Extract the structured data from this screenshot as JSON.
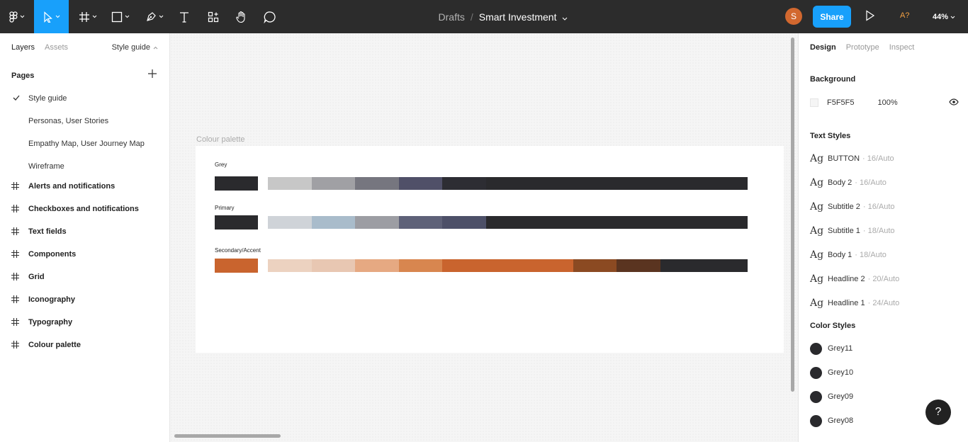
{
  "toolbar": {
    "breadcrumb_root": "Drafts",
    "breadcrumb_sep": "/",
    "file_name": "Smart Investment",
    "avatar_initial": "S",
    "share_label": "Share",
    "a11y_label": "A?",
    "zoom": "44%"
  },
  "left": {
    "tabs": [
      "Layers",
      "Assets"
    ],
    "page_selector": "Style guide",
    "pages_heading": "Pages",
    "pages": [
      "Style guide",
      "Personas, User Stories",
      "Empathy Map, User Journey Map",
      "Wireframe"
    ],
    "layers": [
      "Alerts and notifications",
      "Checkboxes and notifications",
      "Text fields",
      "Components",
      "Grid",
      "Iconography",
      "Typography",
      "Colour palette"
    ]
  },
  "canvas": {
    "frame_label": "Colour palette",
    "palettes": [
      {
        "label": "Grey",
        "main": "#2a2a2d",
        "strip": [
          "#c7c7c7",
          "#a0a0a4",
          "#76767f",
          "#505068",
          "#2d2d33",
          "#2a2a2d",
          "#2a2a2d",
          "#2a2a2d",
          "#2a2a2d",
          "#2a2a2d",
          "#2a2a2d"
        ]
      },
      {
        "label": "Primary",
        "main": "#2a2a2d",
        "strip": [
          "#cfd3d8",
          "#a9bccb",
          "#9c9da3",
          "#5e6178",
          "#4d5068",
          "#2a2a2d",
          "#2a2a2d",
          "#2a2a2d",
          "#2a2a2d",
          "#2a2a2d",
          "#2a2a2d"
        ]
      },
      {
        "label": "Secondary/Accent",
        "main": "#c9642e",
        "strip": [
          "#ecd2c0",
          "#e8c7b2",
          "#e6a982",
          "#d8864f",
          "#c9642e",
          "#c9642e",
          "#c9642e",
          "#8b4a22",
          "#5a3420",
          "#2a2a2d",
          "#2a2a2d"
        ]
      }
    ]
  },
  "right": {
    "tabs": [
      "Design",
      "Prototype",
      "Inspect"
    ],
    "background_heading": "Background",
    "background_hex": "F5F5F5",
    "background_opacity": "100%",
    "background_color": "#f5f5f5",
    "text_styles_heading": "Text Styles",
    "text_styles": [
      {
        "glyph": "Ag",
        "name": "BUTTON",
        "meta": "· 16/Auto"
      },
      {
        "glyph": "Ag",
        "name": "Body 2",
        "meta": "· 16/Auto"
      },
      {
        "glyph": "Ag",
        "name": "Subtitle 2",
        "meta": "· 16/Auto"
      },
      {
        "glyph": "Ag",
        "name": "Subtitle 1",
        "meta": "· 18/Auto"
      },
      {
        "glyph": "Ag",
        "name": "Body 1",
        "meta": "· 18/Auto"
      },
      {
        "glyph": "Ag",
        "name": "Headline 2",
        "meta": "· 20/Auto"
      },
      {
        "glyph": "Ag",
        "name": "Headline 1",
        "meta": "· 24/Auto"
      }
    ],
    "color_styles_heading": "Color Styles",
    "color_styles": [
      {
        "name": "Grey11",
        "color": "#2a2a2d"
      },
      {
        "name": "Grey10",
        "color": "#2a2a2d"
      },
      {
        "name": "Grey09",
        "color": "#2a2a2d"
      },
      {
        "name": "Grey08",
        "color": "#2a2a2d"
      }
    ],
    "help_label": "?"
  }
}
